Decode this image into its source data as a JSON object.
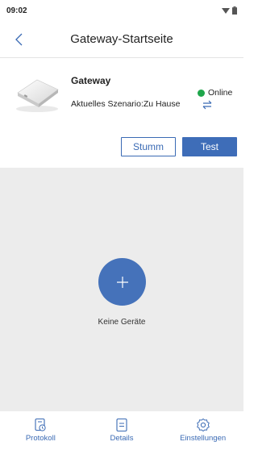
{
  "status_bar": {
    "time": "09:02"
  },
  "header": {
    "title": "Gateway-Startseite"
  },
  "device": {
    "name": "Gateway",
    "scene": "Aktuelles Szenario:Zu Hause",
    "status": "Online",
    "status_color": "#1fa64b"
  },
  "actions": {
    "mute_label": "Stumm",
    "test_label": "Test"
  },
  "content": {
    "empty_label": "Keine Geräte"
  },
  "bottom_nav": {
    "items": [
      {
        "label": "Protokoll",
        "icon": "log-icon"
      },
      {
        "label": "Details",
        "icon": "details-icon"
      },
      {
        "label": "Einstellungen",
        "icon": "settings-icon"
      }
    ]
  },
  "colors": {
    "accent": "#3e6db8",
    "background": "#ececec"
  }
}
